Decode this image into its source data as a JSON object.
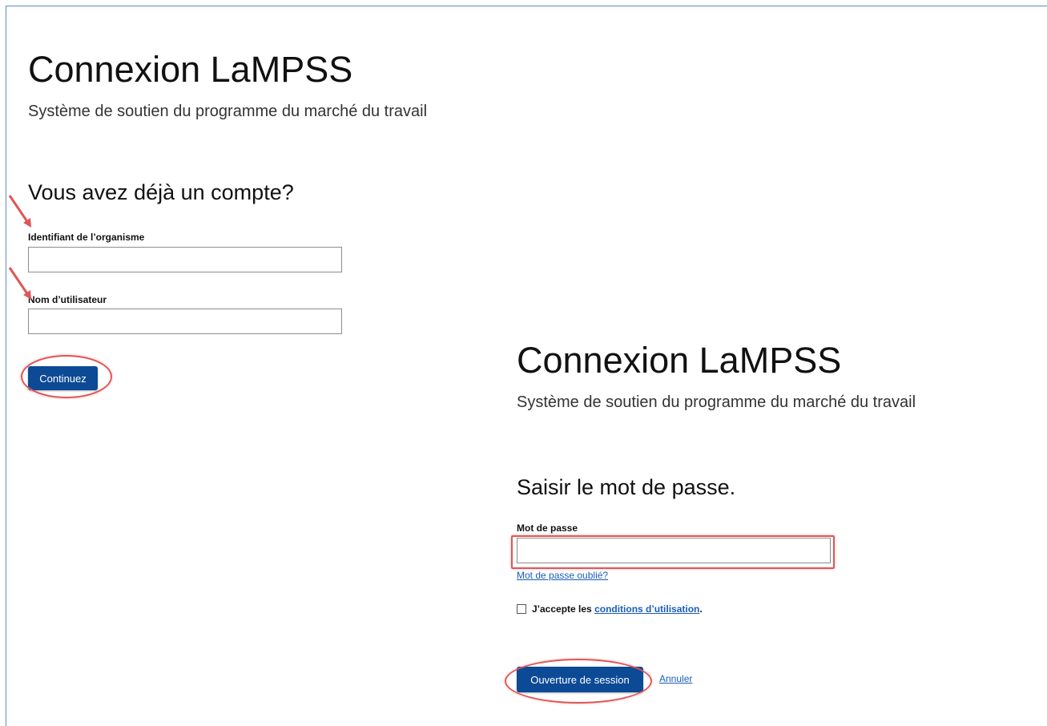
{
  "left_panel": {
    "title": "Connexion LaMPSS",
    "subtitle": "Système de soutien du programme du marché du travail",
    "heading": "Vous avez déjà un compte?",
    "org_id_label": "Identifiant de l’organisme",
    "org_id_value": "",
    "username_label": "Nom d’utilisateur",
    "username_value": "",
    "continue_label": "Continuez"
  },
  "right_panel": {
    "title": "Connexion LaMPSS",
    "subtitle": "Système de soutien du programme du marché du travail",
    "heading": "Saisir le mot de passe.",
    "password_label": "Mot de passe",
    "password_value": "",
    "forgot_link": "Mot de passe oublié?",
    "terms_prefix": "J’accepte les ",
    "terms_link": "conditions d’utilisation",
    "terms_suffix": ".",
    "terms_checked": false,
    "login_label": "Ouverture de session",
    "cancel_label": "Annuler"
  },
  "colors": {
    "button": "#0c4a96",
    "link": "#1a5db8",
    "annotation": "#e05555"
  }
}
